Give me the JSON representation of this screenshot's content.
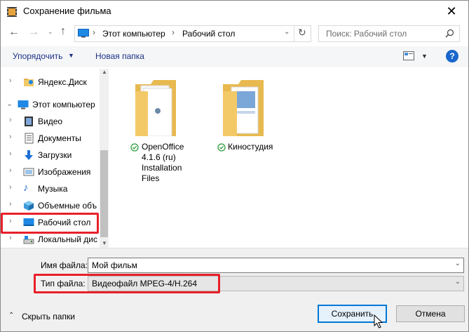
{
  "window": {
    "title": "Сохранение фильма"
  },
  "address_bar": {
    "path": [
      "Этот компьютер",
      "Рабочий стол"
    ],
    "search_placeholder": "Поиск: Рабочий стол"
  },
  "toolbar": {
    "organize_label": "Упорядочить",
    "new_folder_label": "Новая папка",
    "help_label": "?"
  },
  "nav": {
    "items": [
      {
        "label": "Яндекс.Диск"
      },
      {
        "label": "Этот компьютер"
      },
      {
        "label": "Видео"
      },
      {
        "label": "Документы"
      },
      {
        "label": "Загрузки"
      },
      {
        "label": "Изображения"
      },
      {
        "label": "Музыка"
      },
      {
        "label": "Объемные объ"
      },
      {
        "label": "Рабочий стол"
      },
      {
        "label": "Локальный дис"
      }
    ]
  },
  "files": [
    {
      "name_lines": [
        "OpenOffice",
        "4.1.6 (ru)",
        "Installation",
        "Files"
      ]
    },
    {
      "name_lines": [
        "Киностудия"
      ]
    }
  ],
  "form": {
    "filename_label": "Имя файла:",
    "filename_value": "Мой фильм",
    "filetype_label": "Тип файла:",
    "filetype_value": "Видеофайл MPEG-4/H.264"
  },
  "footer": {
    "hide_folders_label": "Скрыть папки",
    "save_label": "Сохранить",
    "cancel_label": "Отмена"
  },
  "colors": {
    "highlight_red": "#e8202a",
    "link_blue": "#1e3287",
    "folder_yellow": "#f3c967"
  }
}
